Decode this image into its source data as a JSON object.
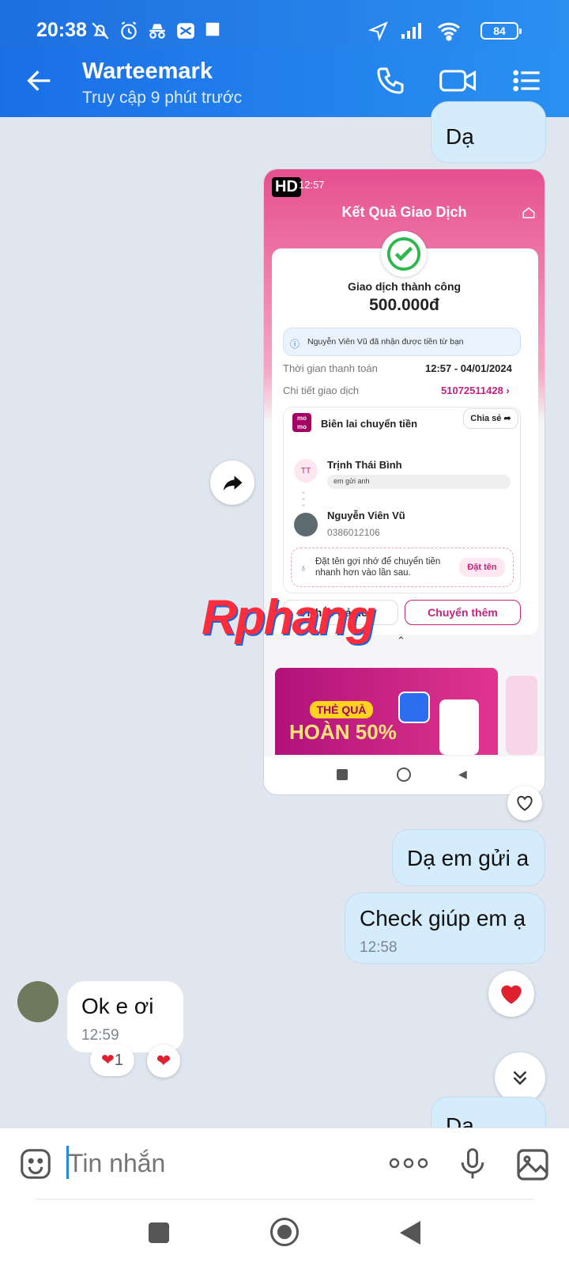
{
  "status": {
    "time": "20:38",
    "battery": "84"
  },
  "header": {
    "contact_name": "Warteemark",
    "last_seen": "Truy cập 9 phút trước"
  },
  "messages": {
    "top_partial": "Dạ",
    "image": {
      "hd_label": "HD",
      "status_time": "12:57",
      "title": "Kết Quả Giao Dịch",
      "success": "Giao dịch thành công",
      "amount": "500.000đ",
      "notice": "Nguyễn Viên Vũ đã nhận được tiền từ bạn",
      "pay_time_label": "Thời gian thanh toán",
      "pay_time": "12:57 - 04/01/2024",
      "detail_label": "Chi tiết giao dịch",
      "detail_id": "51072511428 ›",
      "momo_logo": "mo mo",
      "receipt_title": "Biên lai chuyển tiền",
      "share": "Chia sẻ",
      "sender_initials": "TT",
      "sender": "Trịnh Thái Bình",
      "note": "em gửi anh",
      "receiver": "Nguyễn Viên Vũ",
      "receiver_phone": "0386012106",
      "tip": "Đặt tên gợi nhớ để chuyển tiền nhanh hơn vào lần sau.",
      "tip_button": "Đặt tên",
      "remind": "Nhắc trả tiền",
      "transfer_more": "Chuyển thêm",
      "promo_tag": "THẺ QUÀ",
      "promo": "HOÀN 50%"
    },
    "out1": "Dạ em gửi a",
    "out2": {
      "text": "Check giúp em ạ",
      "time": "12:58"
    },
    "in1": {
      "text": "Ok e ơi",
      "time": "12:59",
      "reaction_count": "1"
    },
    "bottom_partial": "Dạ"
  },
  "composer": {
    "placeholder": "Tin nhắn"
  },
  "watermark": "Rphang",
  "colors": {
    "accent": "#1e6fe0",
    "bubble_out": "#d5ecfd",
    "momo": "#d82d8b"
  }
}
